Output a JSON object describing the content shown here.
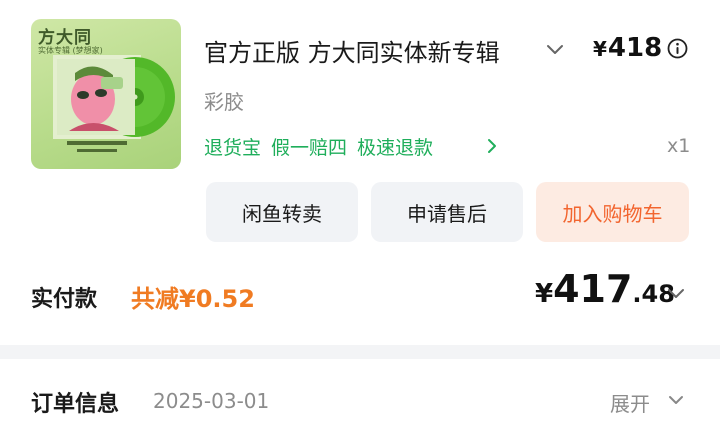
{
  "product": {
    "thumbnail": {
      "cover_title": "方大同",
      "cover_subtitle": "实体专辑 (梦想家)"
    },
    "title": "官方正版 方大同实体新专辑",
    "price": "¥418",
    "price_symbol": "¥",
    "price_amount": "418",
    "variant": "彩胶",
    "perks": [
      "退货宝",
      "假一赔四",
      "极速退款"
    ],
    "quantity": "x1"
  },
  "buttons": {
    "resell": "闲鱼转卖",
    "after_sale": "申请售后",
    "add_to_cart": "加入购物车"
  },
  "payment": {
    "label": "实付款",
    "discount": "共减¥0.52",
    "total_symbol": "¥",
    "total_int": "417",
    "total_dec": ".48"
  },
  "order_info": {
    "label": "订单信息",
    "date": "2025-03-01",
    "expand_label": "展开"
  },
  "colors": {
    "perk_green": "#1fae5b",
    "accent_orange": "#f2652f",
    "discount_orange": "#f07b22"
  }
}
